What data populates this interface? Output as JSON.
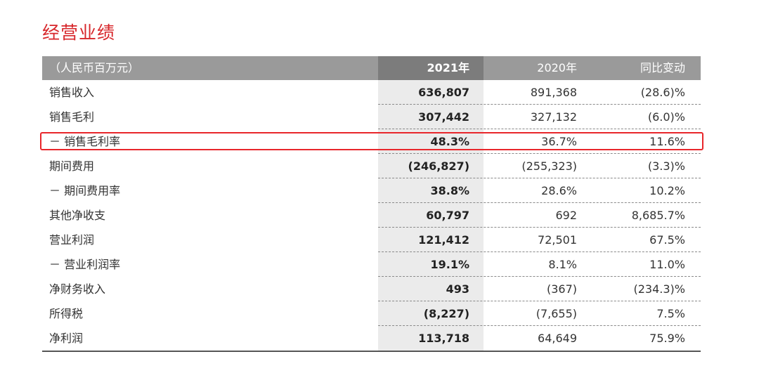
{
  "title": "经营业绩",
  "header": {
    "unit": "（人民币百万元）",
    "col_2021": "2021年",
    "col_2020": "2020年",
    "col_change": "同比变动"
  },
  "rows": [
    {
      "label": "销售收入",
      "v2021": "636,807",
      "v2020": "891,368",
      "change": "(28.6)%"
    },
    {
      "label": "销售毛利",
      "v2021": "307,442",
      "v2020": "327,132",
      "change": "(6.0)%"
    },
    {
      "label": "－ 销售毛利率",
      "v2021": "48.3%",
      "v2020": "36.7%",
      "change": "11.6%"
    },
    {
      "label": "期间费用",
      "v2021": "(246,827)",
      "v2020": "(255,323)",
      "change": "(3.3)%"
    },
    {
      "label": "－ 期间费用率",
      "v2021": "38.8%",
      "v2020": "28.6%",
      "change": "10.2%"
    },
    {
      "label": "其他净收支",
      "v2021": "60,797",
      "v2020": "692",
      "change": "8,685.7%"
    },
    {
      "label": "营业利润",
      "v2021": "121,412",
      "v2020": "72,501",
      "change": "67.5%"
    },
    {
      "label": "－ 营业利润率",
      "v2021": "19.1%",
      "v2020": "8.1%",
      "change": "11.0%"
    },
    {
      "label": "净财务收入",
      "v2021": "493",
      "v2020": "(367)",
      "change": "(234.3)%"
    },
    {
      "label": "所得税",
      "v2021": "(8,227)",
      "v2020": "(7,655)",
      "change": "7.5%"
    },
    {
      "label": "净利润",
      "v2021": "113,718",
      "v2020": "64,649",
      "change": "75.9%"
    }
  ],
  "highlight_row_index": 2,
  "colors": {
    "title": "#d7262a",
    "header_bg": "#9a9a9a",
    "header_2021_bg": "#7c7c7c",
    "col_2021_bg": "#ebebeb",
    "highlight_border": "#e8262b"
  }
}
